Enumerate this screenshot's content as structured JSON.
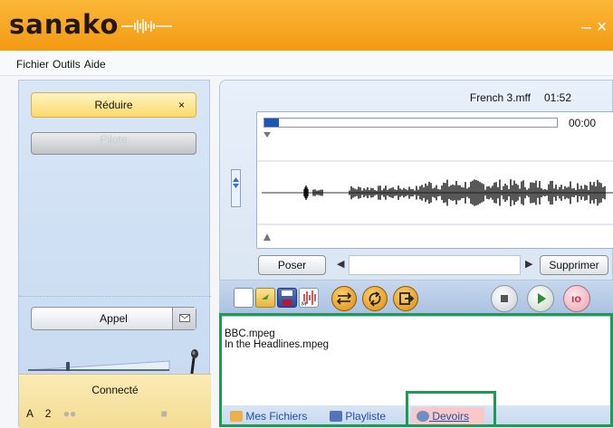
{
  "app": {
    "logo": "sanako",
    "close_label": "×"
  },
  "menu": {
    "items": [
      "Fichier",
      "Outils",
      "Aide"
    ]
  },
  "left": {
    "reduire_label": "Réduire",
    "reduire_close": "×",
    "disabled_label": "Pilote",
    "appel_label": "Appel",
    "appel_icon": "mail-icon",
    "connection_label": "Connecté",
    "row_letter": "A",
    "row_number": "2",
    "volume_level": 0.28
  },
  "player": {
    "file_name": "French 3.mff",
    "duration": "01:52",
    "position": "00:00",
    "progress": 0.05,
    "poser_label": "Poser",
    "supprimer_label": "Supprimer",
    "text_value": ""
  },
  "toolbar": {
    "icons": [
      "new-document-icon",
      "open-folder-icon",
      "save-icon",
      "marker-icon",
      "swap-icon",
      "repeat-icon",
      "export-icon",
      "stop-icon",
      "play-icon",
      "record-icon"
    ],
    "colors": {
      "accent": "#f39a14",
      "play": "#2f8a3a",
      "record": "#c7304a",
      "highlight": "#1f9a55"
    }
  },
  "files": {
    "items": [
      "BBC.mpeg",
      "In the Headlines.mpeg"
    ]
  },
  "tabs": [
    {
      "label": "Mes Fichiers",
      "icon": "people-icon"
    },
    {
      "label": "Playliste",
      "icon": "grid-icon"
    },
    {
      "label": "Devoirs",
      "icon": "assignment-icon"
    }
  ]
}
